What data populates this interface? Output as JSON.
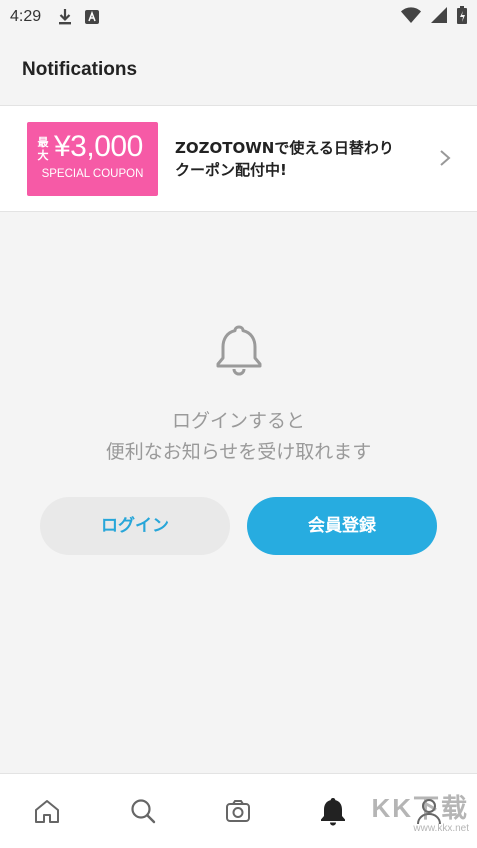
{
  "status_bar": {
    "time": "4:29"
  },
  "header": {
    "title": "Notifications"
  },
  "banner": {
    "coupon_prefix": "最大",
    "coupon_amount": "¥3,000",
    "coupon_subtitle": "SPECIAL COUPON",
    "text_line1": "ZOZOTOWNで使える日替わり",
    "text_line2": "クーポン配付中!",
    "colors": {
      "coupon_bg": "#f65aa6"
    }
  },
  "empty_state": {
    "icon": "bell-icon",
    "line1": "ログインすると",
    "line2": "便利なお知らせを受け取れます",
    "login_label": "ログイン",
    "register_label": "会員登録",
    "colors": {
      "accent": "#27ace0"
    }
  },
  "bottom_nav": {
    "items": [
      {
        "icon": "home-icon"
      },
      {
        "icon": "search-icon"
      },
      {
        "icon": "camera-icon"
      },
      {
        "icon": "bell-icon",
        "active": true
      },
      {
        "icon": "profile-icon"
      }
    ]
  },
  "watermark": {
    "text": "KK下载",
    "url": "www.kkx.net"
  }
}
